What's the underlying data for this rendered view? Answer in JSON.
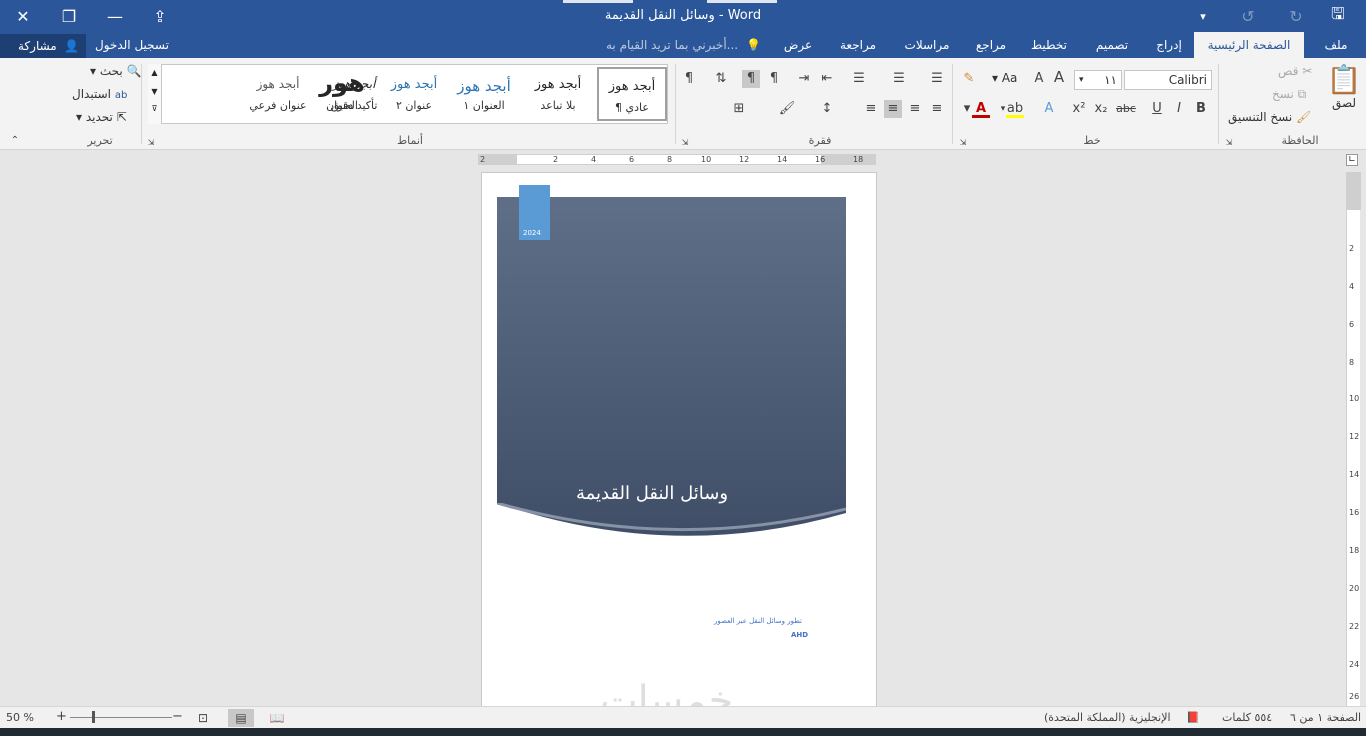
{
  "window": {
    "title": "وسائل النقل القديمة - Word",
    "colors": {
      "accent": "#2b579a",
      "cover_blue": "#5b9bd5",
      "link_blue": "#4472c4"
    }
  },
  "titlebar": {
    "icons": [
      "close-icon",
      "restore-icon",
      "minimize-icon",
      "ribbon-display-icon",
      "dropdown-icon",
      "undo-icon",
      "redo-icon",
      "save-icon"
    ]
  },
  "tabs": {
    "file": "ملف",
    "home": "الصفحة الرئيسية",
    "insert": "إدراج",
    "design": "تصميم",
    "layout": "تخطيط",
    "references": "مراجع",
    "mailings": "مراسلات",
    "review": "مراجعة",
    "view": "عرض",
    "tellme": "أخبرني بما تريد القيام به...",
    "signin": "تسجيل الدخول",
    "share": "مشاركة"
  },
  "ribbon": {
    "clipboard": {
      "label": "الحافظة",
      "paste": "لصق",
      "cut": "قص",
      "copy": "نسخ",
      "format_painter": "نسخ التنسيق"
    },
    "font": {
      "label": "خط",
      "font_name": "Calibri (أساسي)",
      "font_size": "١١",
      "bold": "B",
      "italic": "I",
      "underline": "U",
      "strike": "abc",
      "subscript": "x₂",
      "superscript": "x²",
      "change_case": "Aa"
    },
    "paragraph": {
      "label": "فقرة"
    },
    "styles": {
      "label": "أنماط",
      "items": [
        {
          "preview": "أبجد هوز",
          "name": "¶ عادي"
        },
        {
          "preview": "أبجد هوز",
          "name": "بلا تباعد"
        },
        {
          "preview": "أبجد هوز",
          "name": "العنوان ١"
        },
        {
          "preview": "أبجد هوز",
          "name": "عنوان ٢"
        },
        {
          "preview": "هور",
          "name": "العنوان"
        },
        {
          "preview": "أبجد هوز",
          "name": "عنوان فرعي"
        },
        {
          "preview": "أبجد هوز",
          "name": "تأكيد دقيق"
        }
      ]
    },
    "editing": {
      "label": "تحرير",
      "find": "بحث",
      "replace": "استبدال",
      "select": "تحديد"
    }
  },
  "ruler": {
    "ticks": [
      "2",
      "2",
      "4",
      "6",
      "8",
      "10",
      "12",
      "14",
      "16",
      "18"
    ]
  },
  "vruler": {
    "ticks": [
      "2",
      "4",
      "6",
      "8",
      "10",
      "12",
      "14",
      "16",
      "18",
      "20",
      "22",
      "24",
      "26"
    ]
  },
  "document": {
    "year": "2024",
    "title": "وسائل النقل القديمة",
    "subtitle": "تطور وسائل النقل عبر العصور",
    "author": "AHD"
  },
  "statusbar": {
    "page": "الصفحة ١ من ٦",
    "words": "٥٥٤ كلمات",
    "language": "الإنجليزية (المملكة المتحدة)",
    "zoom": "50 %",
    "zoom_percent": 50,
    "watermark": "خمسات"
  }
}
